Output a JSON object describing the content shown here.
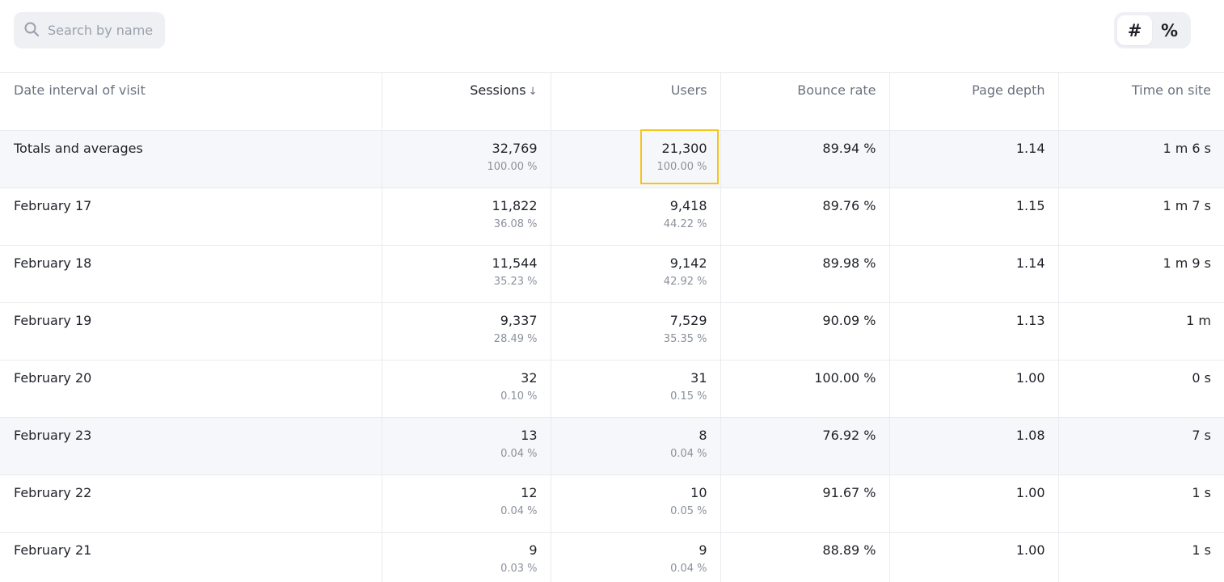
{
  "search": {
    "placeholder": "Search by name",
    "value": ""
  },
  "toggle": {
    "number_label": "#",
    "percent_label": "%",
    "active": "number"
  },
  "table": {
    "columns": [
      {
        "label": "Date interval of visit"
      },
      {
        "label": "Sessions",
        "sort": "↓"
      },
      {
        "label": "Users"
      },
      {
        "label": "Bounce rate"
      },
      {
        "label": "Page depth"
      },
      {
        "label": "Time on site"
      }
    ],
    "rows": [
      {
        "label": "Totals and averages",
        "sessions": "32,769",
        "sessions_pct": "100.00 %",
        "users": "21,300",
        "users_pct": "100.00 %",
        "bounce": "89.94 %",
        "depth": "1.14",
        "time": "1 m 6 s"
      },
      {
        "label": "February 17",
        "sessions": "11,822",
        "sessions_pct": "36.08 %",
        "users": "9,418",
        "users_pct": "44.22 %",
        "bounce": "89.76 %",
        "depth": "1.15",
        "time": "1 m 7 s"
      },
      {
        "label": "February 18",
        "sessions": "11,544",
        "sessions_pct": "35.23 %",
        "users": "9,142",
        "users_pct": "42.92 %",
        "bounce": "89.98 %",
        "depth": "1.14",
        "time": "1 m 9 s"
      },
      {
        "label": "February 19",
        "sessions": "9,337",
        "sessions_pct": "28.49 %",
        "users": "7,529",
        "users_pct": "35.35 %",
        "bounce": "90.09 %",
        "depth": "1.13",
        "time": "1 m"
      },
      {
        "label": "February 20",
        "sessions": "32",
        "sessions_pct": "0.10 %",
        "users": "31",
        "users_pct": "0.15 %",
        "bounce": "100.00 %",
        "depth": "1.00",
        "time": "0 s"
      },
      {
        "label": "February 23",
        "sessions": "13",
        "sessions_pct": "0.04 %",
        "users": "8",
        "users_pct": "0.04 %",
        "bounce": "76.92 %",
        "depth": "1.08",
        "time": "7 s"
      },
      {
        "label": "February 22",
        "sessions": "12",
        "sessions_pct": "0.04 %",
        "users": "10",
        "users_pct": "0.05 %",
        "bounce": "91.67 %",
        "depth": "1.00",
        "time": "1 s"
      },
      {
        "label": "February 21",
        "sessions": "9",
        "sessions_pct": "0.03 %",
        "users": "9",
        "users_pct": "0.04 %",
        "bounce": "88.89 %",
        "depth": "1.00",
        "time": "1 s"
      }
    ]
  },
  "colors": {
    "highlight": "#f5c518",
    "shaded_row": "#f6f7fa",
    "muted_text": "#8b919c"
  }
}
